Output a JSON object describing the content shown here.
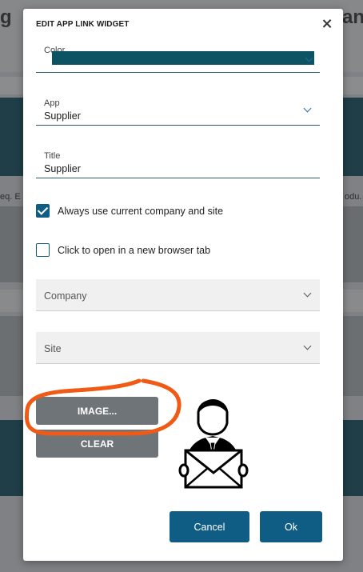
{
  "background": {
    "left_big_text": "g",
    "right_big_text": "an",
    "left_small_text": "eq. E",
    "right_small_text": "odu."
  },
  "dialog": {
    "title": "EDIT APP LINK WIDGET",
    "close_icon": "close-icon",
    "color_field": {
      "label": "Color",
      "value_color": "#0c5363"
    },
    "app_field": {
      "label": "App",
      "value": "Supplier"
    },
    "title_field": {
      "label": "Title",
      "value": "Supplier"
    },
    "checkbox_current_company": {
      "label": "Always use current company and site",
      "checked": true
    },
    "checkbox_new_tab": {
      "label": "Click to open in a new browser tab",
      "checked": false
    },
    "company_select": {
      "label": "Company"
    },
    "site_select": {
      "label": "Site"
    },
    "image_button": "IMAGE...",
    "clear_button": "CLEAR",
    "preview_icon": "delivery-person-with-envelope-icon",
    "cancel_button": "Cancel",
    "ok_button": "Ok"
  },
  "colors": {
    "primary": "#0f5d85",
    "annotation": "#f05a14"
  }
}
